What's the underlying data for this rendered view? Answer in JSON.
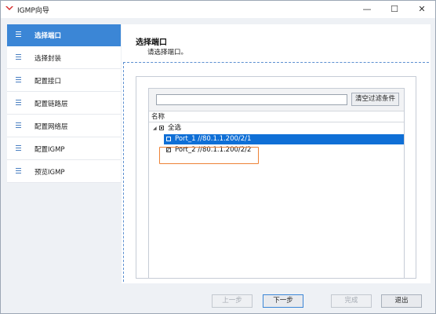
{
  "window": {
    "title": "IGMP向导",
    "minimize": "—",
    "maximize": "☐",
    "close": "✕"
  },
  "sidebar": {
    "items": [
      {
        "label": "选择端口",
        "active": true
      },
      {
        "label": "选择封装"
      },
      {
        "label": "配置接口"
      },
      {
        "label": "配置链路层"
      },
      {
        "label": "配置网络层"
      },
      {
        "label": "配置IGMP"
      },
      {
        "label": "预览IGMP"
      }
    ]
  },
  "page": {
    "heading": "选择端口",
    "subheading": "请选择端口。"
  },
  "filter": {
    "value": "",
    "clear_label": "清空过滤条件"
  },
  "tree": {
    "column_header": "名称",
    "select_all_label": "全选",
    "ports": [
      {
        "label": "Port_1 //80.1.1.200/2/1",
        "checked": false,
        "selected": true
      },
      {
        "label": "Port_2 //80.1.1.200/2/2",
        "checked": true,
        "selected": false
      }
    ]
  },
  "footer": {
    "prev": "上一步",
    "next": "下一步",
    "finish": "完成",
    "exit": "退出"
  },
  "colors": {
    "accent": "#3b86d6",
    "selection": "#0f6fd6",
    "highlight": "#ee8236"
  }
}
